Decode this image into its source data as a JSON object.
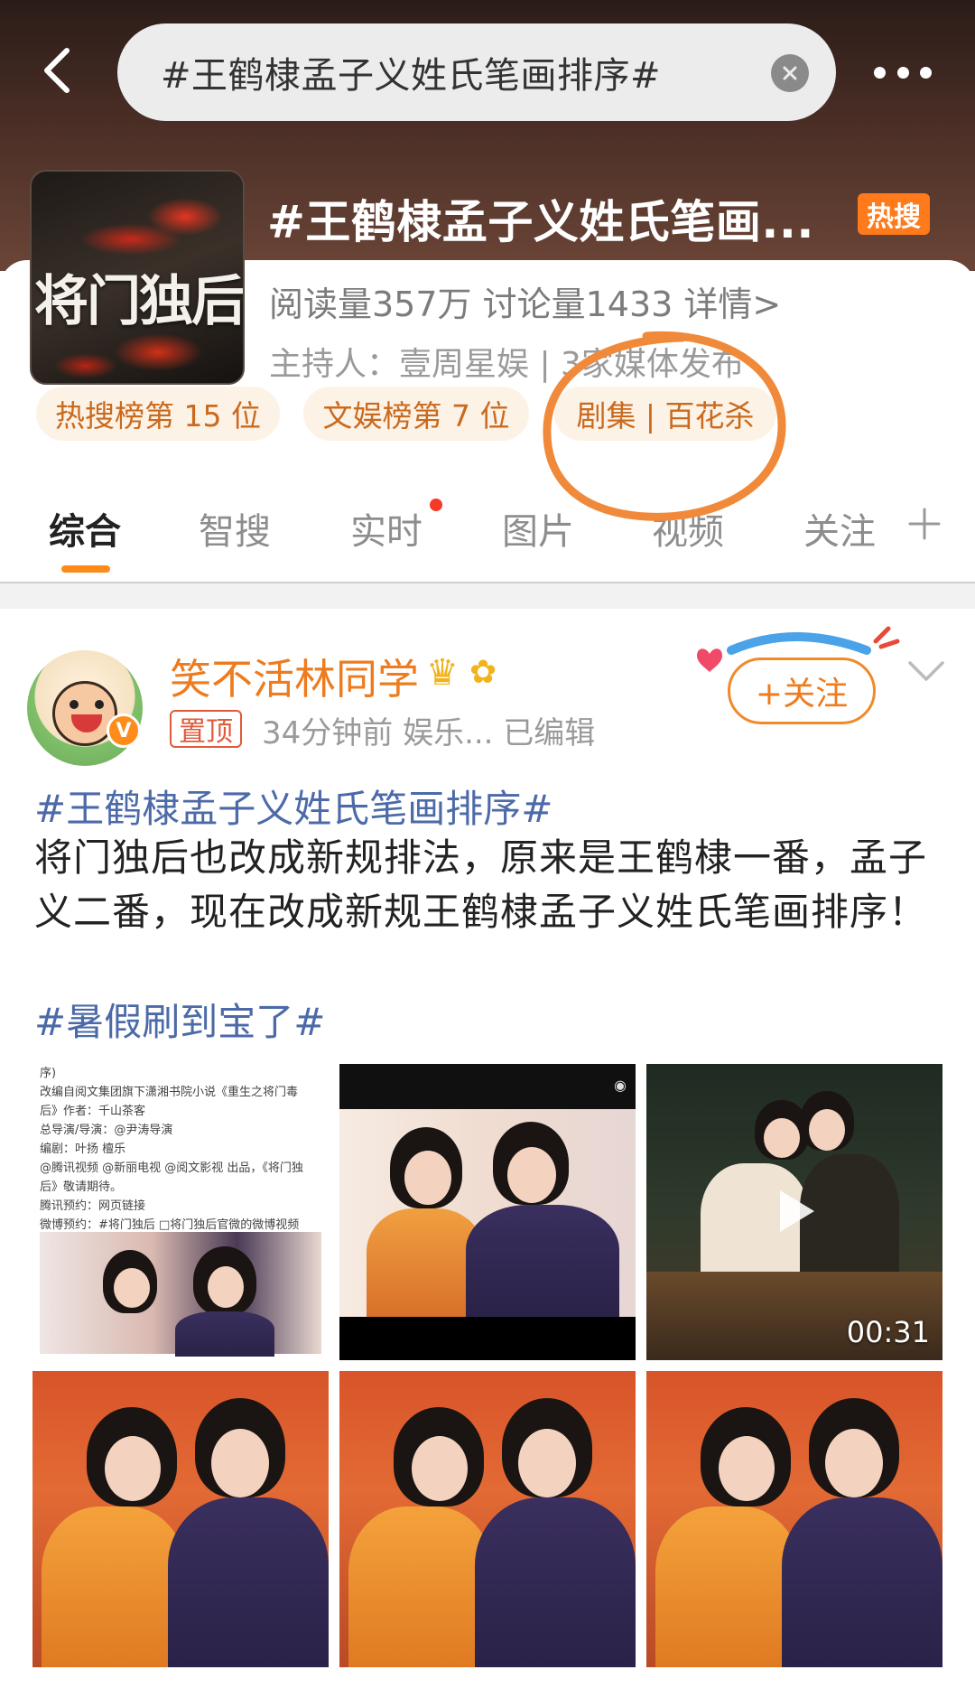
{
  "search": {
    "query": "#王鹤棣孟子义姓氏笔画排序#"
  },
  "topic": {
    "cover_title": "将门独后",
    "title": "#王鹤棣孟子义姓氏笔画...",
    "hot_badge": "热搜",
    "stats": "阅读量357万  讨论量1433  详情>",
    "host": "主持人：壹周星娱 | 3家媒体发布",
    "ranks": [
      "热搜榜第 15 位",
      "文娱榜第 7 位",
      "剧集 | 百花杀"
    ]
  },
  "tabs": [
    "综合",
    "智搜",
    "实时",
    "图片",
    "视频",
    "关注"
  ],
  "post": {
    "username": "笑不活林同学",
    "pin_label": "置顶",
    "meta": "34分钟前  娱乐...  已编辑",
    "follow_label": "+关注",
    "hashtag": "#王鹤棣孟子义姓氏笔画排序#",
    "body": "将门独后也改成新规排法，原来是王鹤棣一番，孟子义二番，现在改成新规王鹤棣孟子义姓氏笔画排序！",
    "hashtag2": "#暑假刷到宝了#",
    "video_duration": "00:31"
  },
  "thumbnail_doc": {
    "lines": [
      "序)",
      "改编自阅文集团旗下潇湘书院小说《重生之将门毒",
      "后》作者：千山茶客",
      "总导演/导演：@尹涛导演",
      "编剧：叶扬 檀乐",
      "@腾讯视频 @新丽电视 @阅文影视 出品，《将门独",
      "后》敬请期待。",
      "腾讯预约：网页链接",
      "微博预约：#将门独后 □将门独后官微的微博视频"
    ]
  },
  "colors": {
    "accent_orange": "#ff8a1a",
    "link_blue": "#4c6aa8",
    "annotation": "#f08a3a"
  }
}
